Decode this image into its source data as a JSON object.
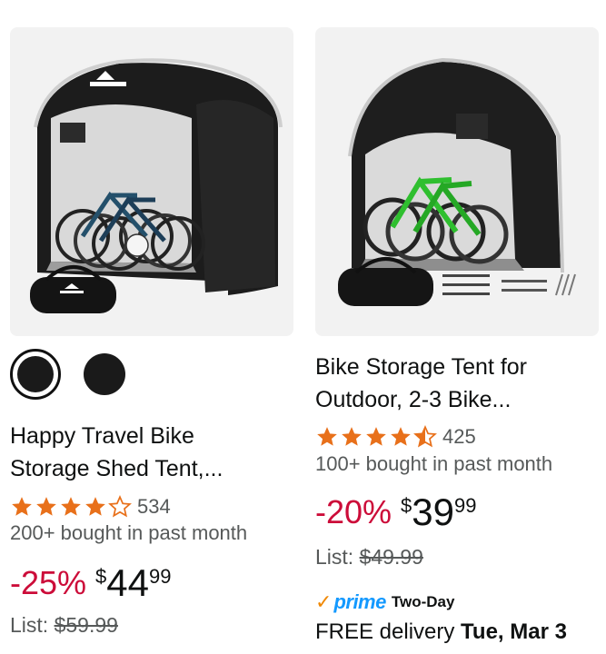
{
  "products": [
    {
      "image_alt": "Happy Travel",
      "swatches": [
        "black-selected",
        "black"
      ],
      "title_line1": "Happy Travel Bike",
      "title_line2": "Storage Shed Tent,...",
      "rating": 4.5,
      "rating_count": "534",
      "bought": "200+ bought in past month",
      "discount": "-25%",
      "price_symbol": "$",
      "price_whole": "44",
      "price_fraction": "99",
      "list_label": "List:",
      "list_price": "$59.99"
    },
    {
      "title_line1": "Bike Storage Tent for",
      "title_line2": "Outdoor, 2-3 Bike...",
      "rating": 4.5,
      "rating_count": "425",
      "bought": "100+ bought in past month",
      "discount": "-20%",
      "price_symbol": "$",
      "price_whole": "39",
      "price_fraction": "99",
      "list_label": "List:",
      "list_price": "$49.99",
      "prime_check": "✓",
      "prime_label": "prime",
      "prime_speed": "Two-Day",
      "delivery_prefix": "FREE delivery",
      "delivery_date": "Tue, Mar 3"
    }
  ],
  "colors": {
    "star": "#e8701a",
    "discount": "#cc0c39",
    "prime_blue": "#1399ff",
    "prime_check": "#f08804",
    "muted_text": "#565959"
  }
}
